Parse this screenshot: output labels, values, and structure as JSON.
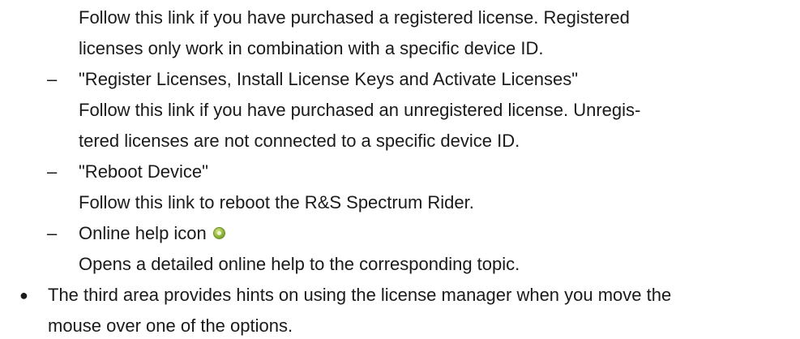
{
  "content": {
    "lines": [
      "Follow this link if you have purchased a registered license. Registered",
      "licenses only work in combination with a specific device ID.",
      "\"Register Licenses, Install License Keys and Activate Licenses\"",
      "Follow this link if you have purchased an unregistered license. Unregis-",
      "tered licenses are not connected to a specific device ID.",
      "\"Reboot Device\"",
      "Follow this link to reboot the R&S Spectrum Rider.",
      "Online help icon",
      "Opens a detailed online help to the corresponding topic.",
      "The third area provides hints on using the license manager when you move the",
      "mouse over one of the options."
    ],
    "dash": "–",
    "bullet": "●",
    "icons": {
      "help": "online-help-icon"
    }
  }
}
